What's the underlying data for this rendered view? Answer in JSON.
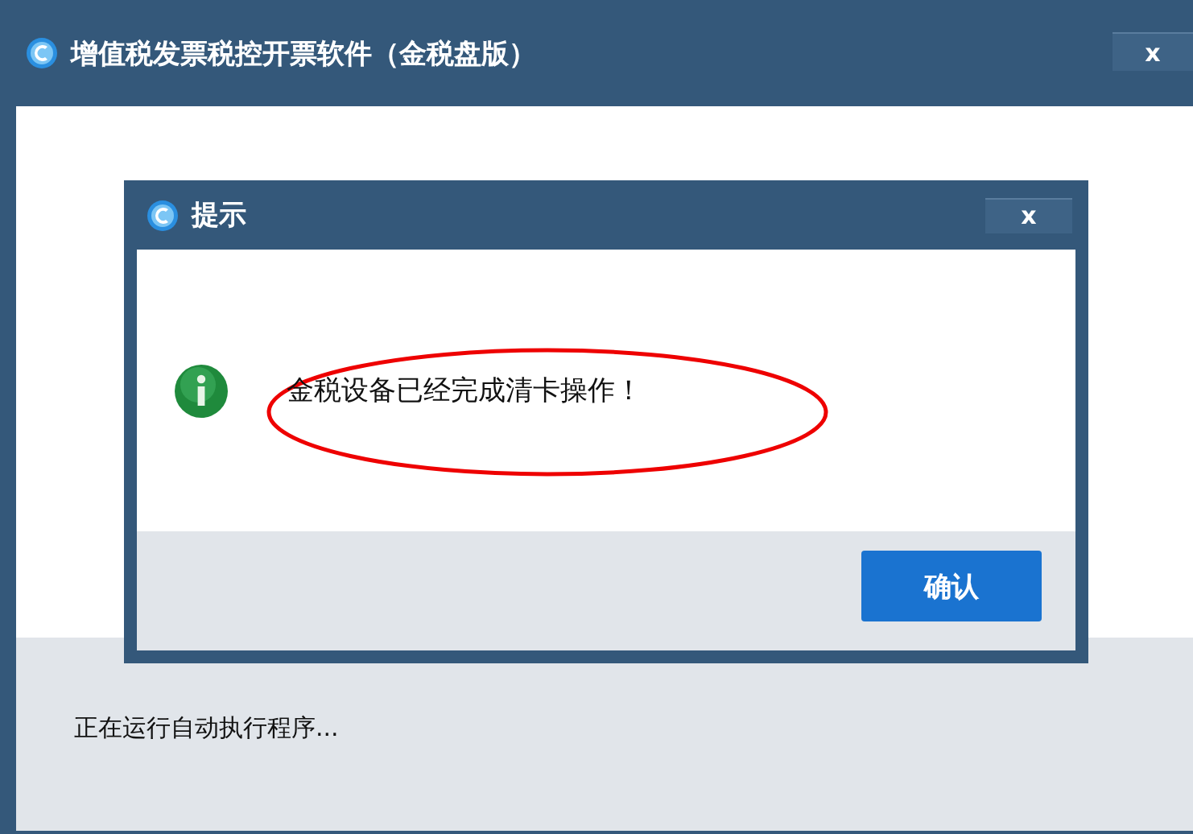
{
  "window": {
    "title": "增值税发票税控开票软件（金税盘版）",
    "close": "x"
  },
  "status_text": "正在运行自动执行程序...",
  "dialog": {
    "title": "提示",
    "close": "x",
    "message": "金税设备已经完成清卡操作！",
    "buttons": [
      "确认"
    ]
  }
}
